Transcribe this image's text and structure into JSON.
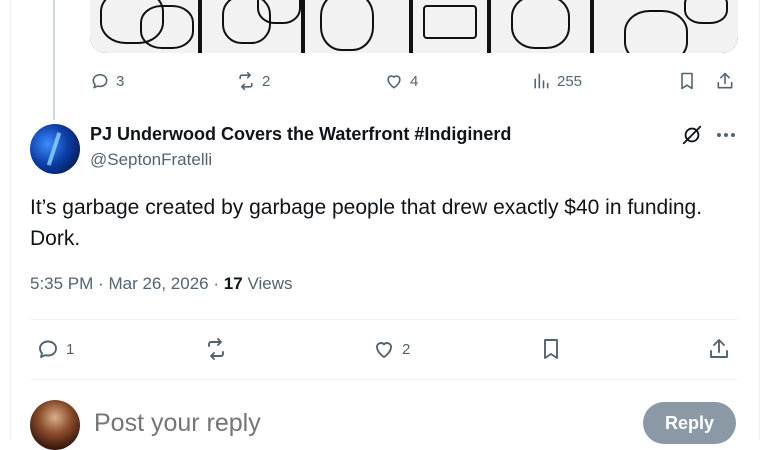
{
  "prev_tweet": {
    "actions": {
      "reply_count": "3",
      "repost_count": "2",
      "like_count": "4",
      "view_count": "255"
    }
  },
  "tweet": {
    "display_name": "PJ Underwood Covers the Waterfront #Indiginerd",
    "handle": "@SeptonFratelli",
    "text_line1": "It’s garbage created by garbage people that drew exactly $40 in funding.",
    "text_line2": "Dork.",
    "time": "5:35 PM",
    "dot1": "·",
    "date": "Mar 26, 2026",
    "dot2": "·",
    "views_count": "17",
    "views_label": "Views",
    "actions": {
      "reply_count": "1",
      "repost_count": "",
      "like_count": "2"
    }
  },
  "reply_box": {
    "placeholder": "Post your reply",
    "button_label": "Reply"
  },
  "colors": {
    "text_primary": "#0f1419",
    "text_secondary": "#536471",
    "reply_button_disabled": "#8b98a5",
    "divider": "#eff3f4"
  },
  "icons": [
    "reply-icon",
    "repost-icon",
    "like-icon",
    "views-icon",
    "bookmark-icon",
    "share-icon",
    "grok-icon",
    "more-icon"
  ]
}
